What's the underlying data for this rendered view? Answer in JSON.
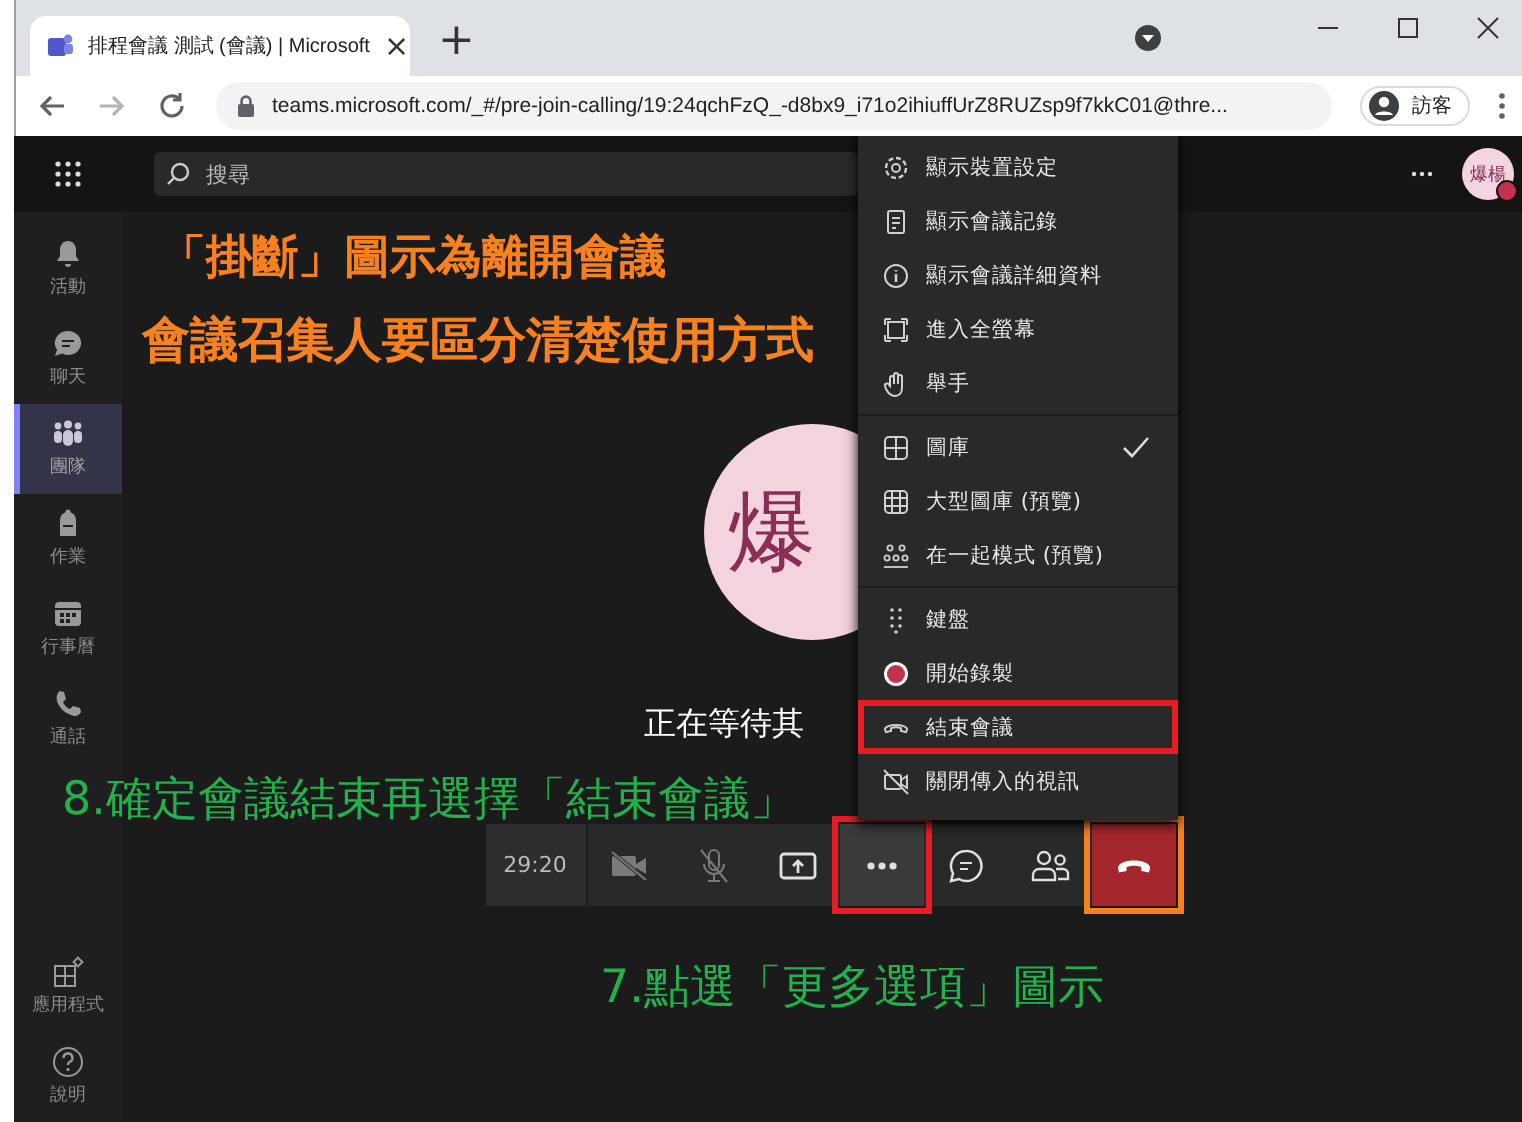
{
  "browser": {
    "tab": {
      "title": "排程會議 測試 (會議) | Microsoft",
      "close": "×"
    },
    "new_tab": "+",
    "address": "teams.microsoft.com/_#/pre-join-calling/19:24qchFzQ_-d8bx9_i71o2ihiuffUrZ8RUZsp9f7kkC01@thre...",
    "profile": "訪客"
  },
  "topbar": {
    "search": {
      "placeholder": "搜尋"
    },
    "avatar": "爆楊"
  },
  "rail": {
    "items": [
      {
        "kind": "bell",
        "label": "活動",
        "selected": false
      },
      {
        "kind": "chat",
        "label": "聊天",
        "selected": false
      },
      {
        "kind": "teams",
        "label": "團隊",
        "selected": true
      },
      {
        "kind": "assignment",
        "label": "作業",
        "selected": false
      },
      {
        "kind": "calendar",
        "label": "行事曆",
        "selected": false
      },
      {
        "kind": "phone",
        "label": "通話",
        "selected": false
      }
    ],
    "bottom": [
      {
        "kind": "apps",
        "label": "應用程式",
        "selected": false
      },
      {
        "kind": "help",
        "label": "說明",
        "selected": false
      }
    ]
  },
  "stage": {
    "avatar": "爆",
    "waiting": "正在等待其"
  },
  "menu": {
    "groups": [
      [
        {
          "kind": "settings",
          "label": "顯示裝置設定"
        },
        {
          "kind": "notes",
          "label": "顯示會議記錄"
        },
        {
          "kind": "info",
          "label": "顯示會議詳細資料"
        },
        {
          "kind": "fullscreen",
          "label": "進入全螢幕"
        },
        {
          "kind": "hand",
          "label": "舉手"
        }
      ],
      [
        {
          "kind": "gallery",
          "label": "圖庫",
          "checked": true
        },
        {
          "kind": "large-gallery",
          "label": "大型圖庫 (預覽)",
          "checked": false
        },
        {
          "kind": "together",
          "label": "在一起模式 (預覽)",
          "checked": false
        }
      ],
      [
        {
          "kind": "keypad",
          "label": "鍵盤"
        },
        {
          "kind": "record",
          "label": "開始錄製"
        },
        {
          "kind": "end",
          "label": "結束會議",
          "callout": {
            "color": "#e81c24"
          }
        },
        {
          "kind": "video-off",
          "label": "關閉傳入的視訊"
        }
      ]
    ]
  },
  "call_bar": {
    "timer": "29:20",
    "buttons": [
      {
        "kind": "camera-off"
      },
      {
        "kind": "mic-off"
      },
      {
        "kind": "share"
      },
      {
        "kind": "more",
        "callout": {
          "color": "#e81c24"
        }
      },
      {
        "kind": "chat"
      },
      {
        "kind": "people"
      },
      {
        "kind": "hangup",
        "callout": {
          "color": "#f7801f"
        }
      }
    ]
  },
  "annotations": [
    {
      "kind": "title",
      "text": "「掛斷」圖示為離開會議",
      "color": "#f7801f"
    },
    {
      "kind": "subtitle",
      "text": "會議召集人要區分清楚使用方式",
      "color": "#f7801f"
    },
    {
      "kind": "step8",
      "text": "8.確定會議結束再選擇「結束會議」",
      "color": "#22b14c"
    },
    {
      "kind": "step7",
      "text": "7.點選「更多選項」圖示",
      "color": "#22b14c"
    }
  ]
}
